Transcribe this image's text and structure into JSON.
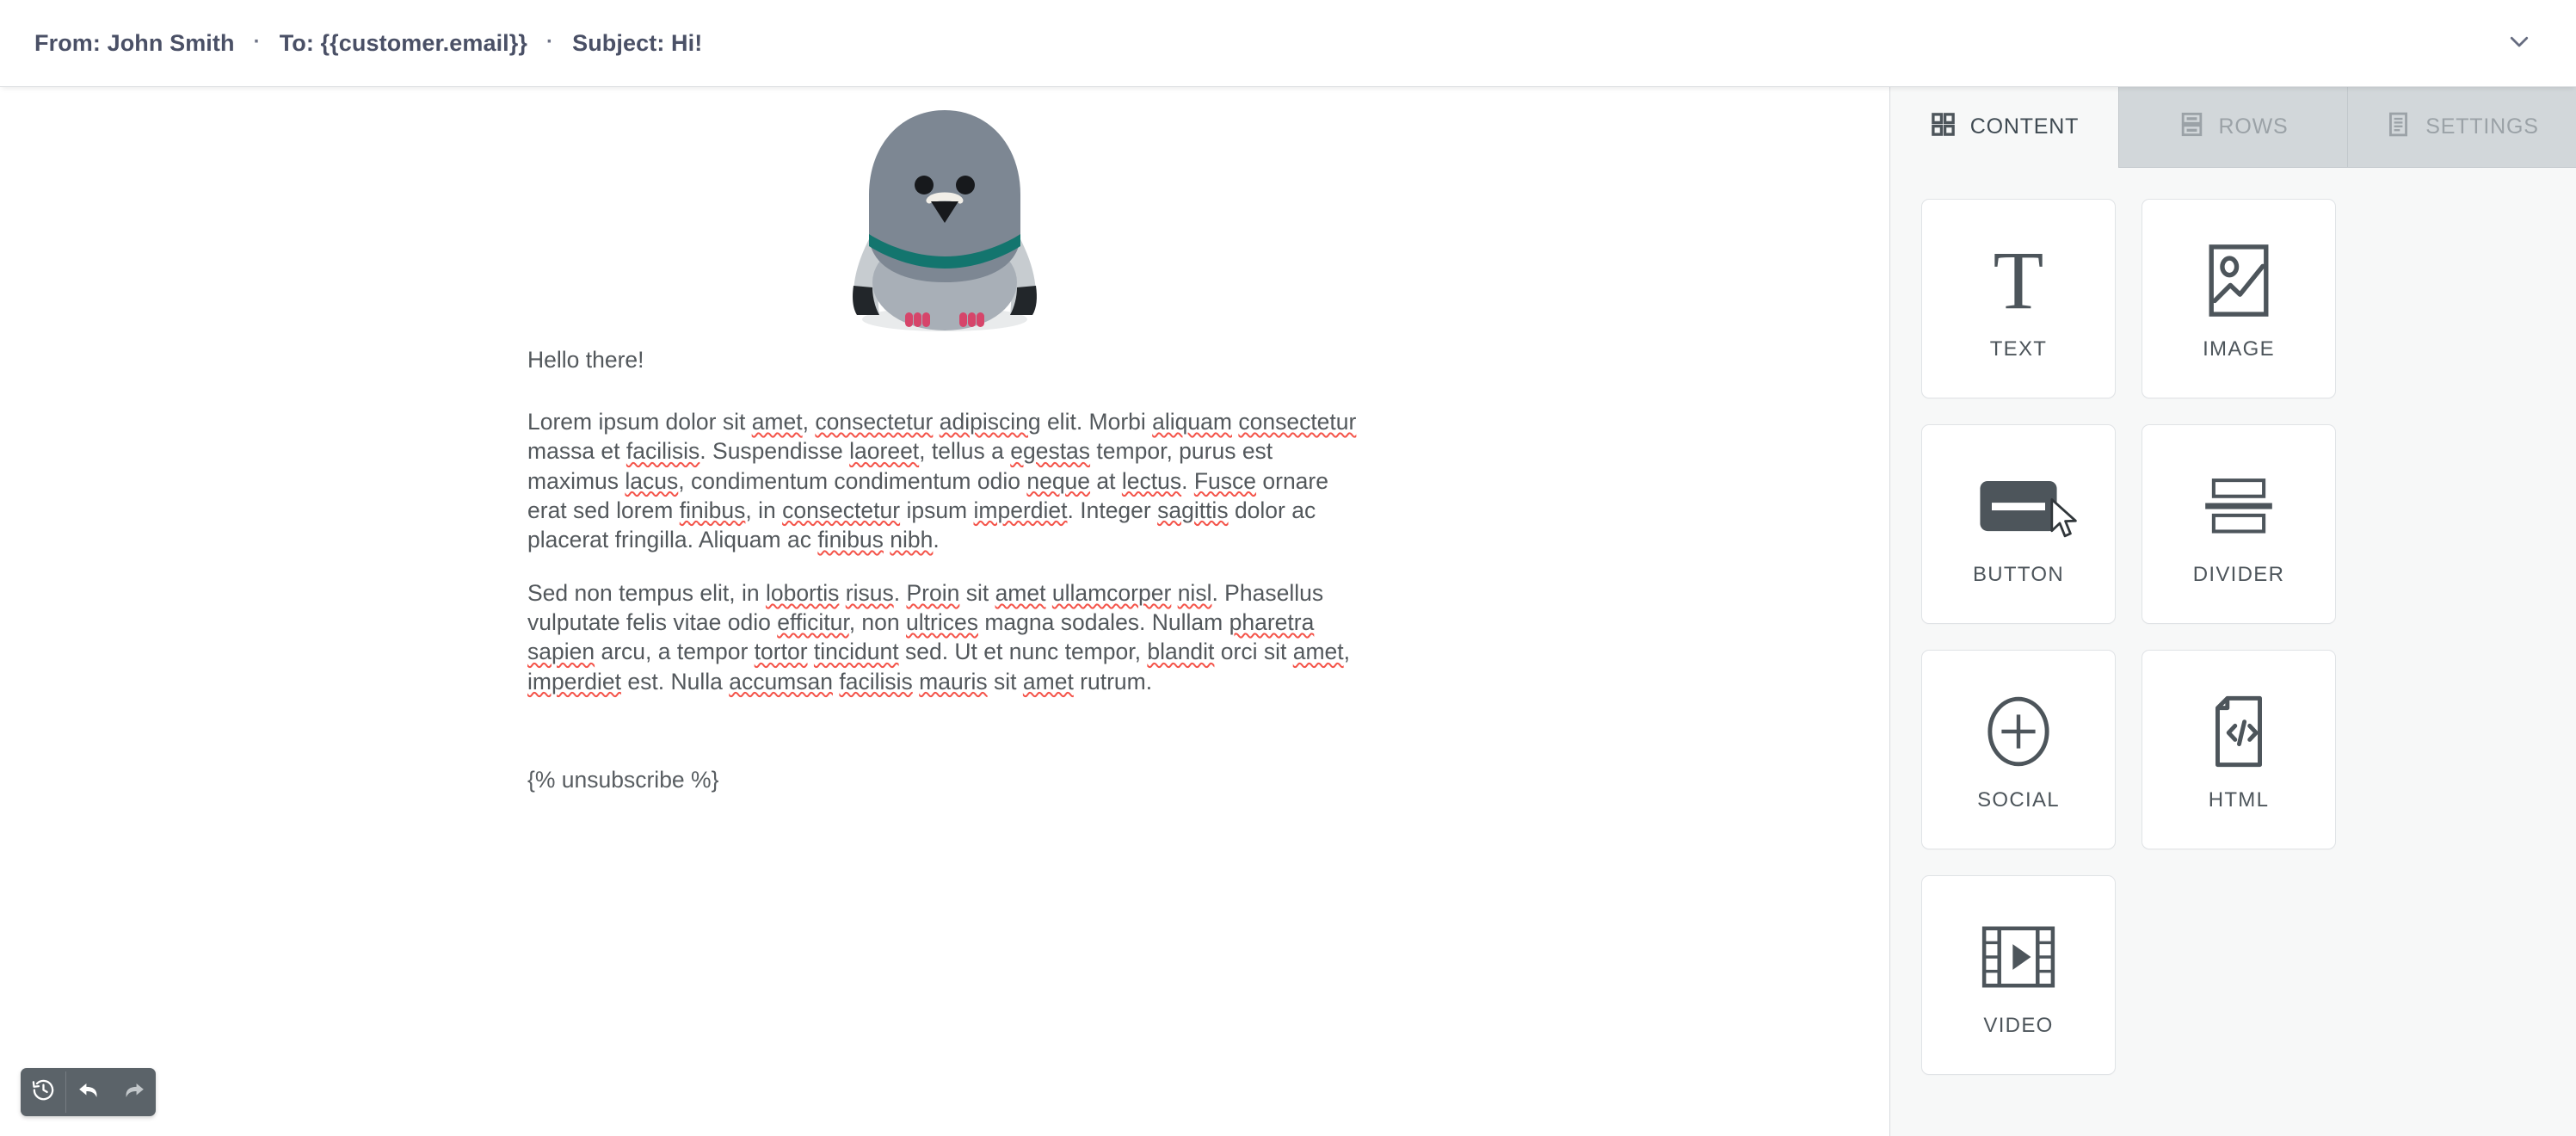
{
  "header": {
    "from_label": "From: John Smith",
    "to_label": "To: {{customer.email}}",
    "subject_label": "Subject: Hi!",
    "separator": "·",
    "collapse_icon": "chevron-down-icon"
  },
  "email": {
    "hero_alt": "pigeon-illustration",
    "greeting": "Hello there!",
    "paragraph_1": "Lorem ipsum dolor sit amet, consectetur adipiscing elit. Morbi aliquam consectetur massa et facilisis. Suspendisse laoreet, tellus a egestas tempor, purus est maximus lacus, condimentum condimentum odio neque at lectus. Fusce ornare erat sed lorem finibus, in consectetur ipsum imperdiet. Integer sagittis dolor ac placerat fringilla. Aliquam ac finibus nibh.",
    "paragraph_2": "Sed non tempus elit, in lobortis risus. Proin sit amet ullamcorper nisl. Phasellus vulputate felis vitae odio efficitur, non ultrices magna sodales. Nullam pharetra sapien arcu, a tempor tortor tincidunt sed. Ut et nunc tempor, blandit orci sit amet, imperdiet est. Nulla accumsan facilisis mauris sit amet rutrum.",
    "unsubscribe": "{% unsubscribe %}"
  },
  "history_toolbar": {
    "history_icon": "history-clock-icon",
    "undo_icon": "undo-arrow-icon",
    "redo_icon": "redo-arrow-icon"
  },
  "panel": {
    "tabs": [
      {
        "label": "CONTENT",
        "icon": "grid-squares-icon",
        "active": true
      },
      {
        "label": "ROWS",
        "icon": "rows-layout-icon",
        "active": false
      },
      {
        "label": "SETTINGS",
        "icon": "document-lines-icon",
        "active": false
      }
    ],
    "tiles": [
      {
        "label": "TEXT",
        "icon": "text-t-icon"
      },
      {
        "label": "IMAGE",
        "icon": "image-picture-icon"
      },
      {
        "label": "BUTTON",
        "icon": "button-icon"
      },
      {
        "label": "DIVIDER",
        "icon": "divider-icon"
      },
      {
        "label": "SOCIAL",
        "icon": "social-plus-circle-icon"
      },
      {
        "label": "HTML",
        "icon": "html-code-file-icon"
      },
      {
        "label": "VIDEO",
        "icon": "video-filmstrip-play-icon"
      }
    ]
  },
  "colors": {
    "header_text": "#4a5066",
    "panel_bg": "#f7f8f8",
    "tab_inactive_bg": "#d2d7da",
    "tile_border": "#e0e3e6",
    "icon_dark": "#4d555b",
    "toolbar_bg": "#5b6369",
    "spellcheck_underline": "#f4544a",
    "pigeon_body": "#7d8793",
    "pigeon_band": "#13756e",
    "pigeon_feet": "#d6456a",
    "pigeon_wing": "#c7ccd0",
    "pigeon_wingtip": "#22262a"
  }
}
